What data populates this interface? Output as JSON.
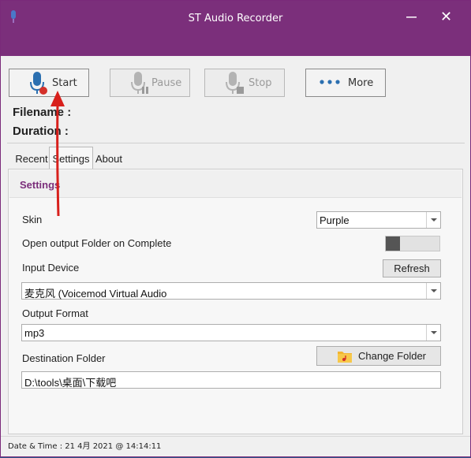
{
  "window": {
    "title": "ST Audio Recorder",
    "close_glyph": "✕"
  },
  "toolbar": {
    "start_label": "Start",
    "pause_label": "Pause",
    "stop_label": "Stop",
    "more_label": "More"
  },
  "info": {
    "filename_label": "Filename :",
    "duration_label": "Duration :"
  },
  "tabs": [
    "Recent",
    "Settings",
    "About"
  ],
  "settings": {
    "section_title": "Settings",
    "skin_label": "Skin",
    "skin_value": "Purple",
    "open_folder_label": "Open output Folder on Complete",
    "open_folder_on": false,
    "input_device_label": "Input Device",
    "refresh_label": "Refresh",
    "input_device_value": "麦克风 (Voicemod Virtual Audio",
    "output_format_label": "Output Format",
    "output_format_value": "mp3",
    "destination_label": "Destination Folder",
    "change_folder_label": "Change Folder",
    "destination_value": "D:\\tools\\桌面\\下载吧"
  },
  "status": {
    "datetime": "Date & Time : 21 4月 2021 @ 14:14:11"
  },
  "colors": {
    "accent": "#7b2f7b",
    "mic_blue": "#2b6fb0",
    "record_red": "#d4302a",
    "folder": "#f2b531"
  },
  "icons": {
    "start": "microphone-record-icon",
    "pause": "microphone-pause-icon",
    "stop": "microphone-stop-icon",
    "more": "dots-icon",
    "folder": "folder-music-icon"
  }
}
